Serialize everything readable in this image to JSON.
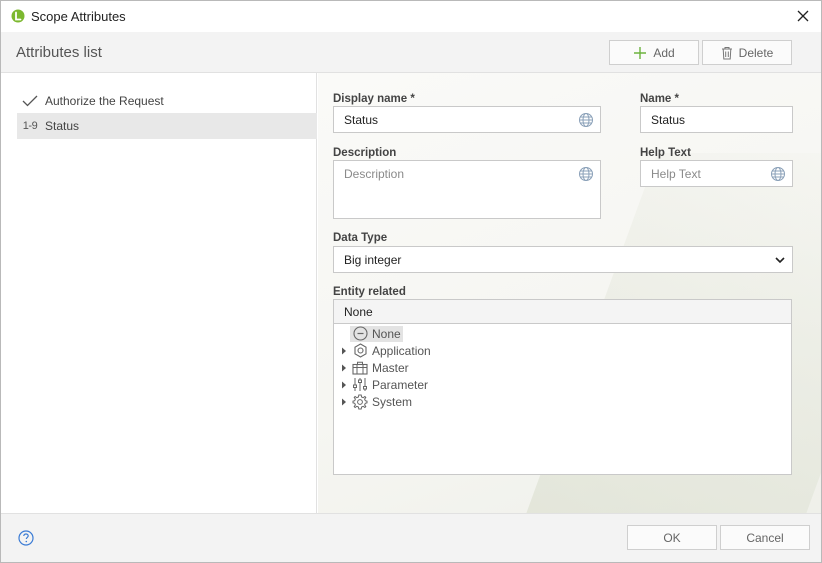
{
  "window": {
    "title": "Scope Attributes",
    "icon": "app-leaf-icon",
    "accent": "#7cb82f"
  },
  "header": {
    "title": "Attributes list",
    "add_label": "Add",
    "delete_label": "Delete"
  },
  "list": {
    "items": [
      {
        "label": "Authorize the Request",
        "icon": "check-icon"
      },
      {
        "label": "Status",
        "icon": "integer-icon",
        "icon_text": "1-9",
        "selected": true
      }
    ]
  },
  "form": {
    "display_name_label": "Display name *",
    "display_name_value": "Status",
    "name_label": "Name *",
    "name_value": "Status",
    "description_label": "Description",
    "description_placeholder": "Description",
    "help_text_label": "Help Text",
    "help_text_placeholder": "Help Text",
    "data_type_label": "Data Type",
    "data_type_value": "Big integer",
    "entity_label": "Entity related",
    "entity_selected": "None",
    "tree": [
      {
        "label": "None",
        "icon": "minus-circle-icon",
        "selected": true,
        "expandable": false
      },
      {
        "label": "Application",
        "icon": "hexagon-icon",
        "expandable": true
      },
      {
        "label": "Master",
        "icon": "briefcase-icon",
        "expandable": true
      },
      {
        "label": "Parameter",
        "icon": "sliders-icon",
        "expandable": true
      },
      {
        "label": "System",
        "icon": "gear-icon",
        "expandable": true
      }
    ]
  },
  "footer": {
    "ok_label": "OK",
    "cancel_label": "Cancel"
  }
}
